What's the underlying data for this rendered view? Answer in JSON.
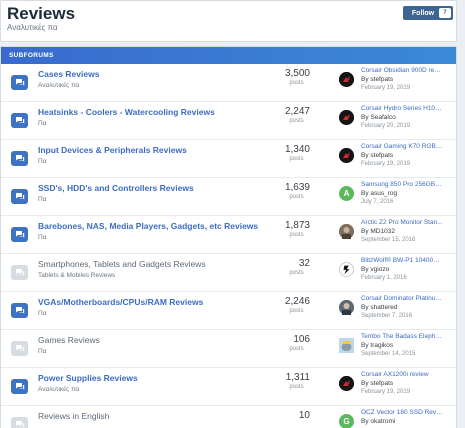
{
  "header": {
    "title": "Reviews",
    "subtitle": "Αναλυτικές πα",
    "follow_label": "Follow",
    "follow_count": "7"
  },
  "section": {
    "title": "SUBFORUMS"
  },
  "colors": {
    "accent": "#3d72c4",
    "read_icon": "#d7dce2",
    "link": "#3d6cc0",
    "follow_btn": "#3d6594"
  },
  "rows": [
    {
      "name": "Cases Reviews",
      "desc": "Αναλυτικές πα",
      "count": "3,500",
      "count_label": "posts",
      "unread": true,
      "last_title": "Corsair Obsidian 900D revi...",
      "last_by": "By stefpats",
      "last_date": "February 19, 2019",
      "avatar": "corsair",
      "avatar_letter": ""
    },
    {
      "name": "Heatsinks - Coolers - Watercooling Reviews",
      "desc": "Πα",
      "count": "2,247",
      "count_label": "posts",
      "unread": true,
      "last_title": "Corsair Hydro Series H100i...",
      "last_by": "By Seafalco",
      "last_date": "February 20, 2019",
      "avatar": "corsair",
      "avatar_letter": ""
    },
    {
      "name": "Input Devices & Peripherals Reviews",
      "desc": "Πα",
      "count": "1,340",
      "count_label": "posts",
      "unread": true,
      "last_title": "Corsair Gaming K70 RGB Ful...",
      "last_by": "By stefpats",
      "last_date": "February 19, 2019",
      "avatar": "corsair",
      "avatar_letter": ""
    },
    {
      "name": "SSD's, HDD's and Controllers Reviews",
      "desc": "Πα",
      "count": "1,639",
      "count_label": "posts",
      "unread": true,
      "last_title": "Samsung 850 Pro 256GB SSD ...",
      "last_by": "By asus_rog",
      "last_date": "July 7, 2016",
      "avatar": "letter",
      "avatar_letter": "A"
    },
    {
      "name": "Barebones, NAS, Media Players, Gadgets, etc Reviews",
      "desc": "Πα",
      "count": "1,873",
      "count_label": "posts",
      "unread": true,
      "last_title": "Arctic Z2 Pro Monitor Stan...",
      "last_by": "By MD1032",
      "last_date": "September 15, 2016",
      "avatar": "photo",
      "avatar_letter": ""
    },
    {
      "name": "Smartphones, Tablets and Gadgets Reviews",
      "desc": "Tablets & Mobiles Reviews",
      "count": "32",
      "count_label": "posts",
      "unread": false,
      "last_title": "BlitzWolf® BW-P1 10400mAh ...",
      "last_by": "By vgiozo",
      "last_date": "February 1, 2016",
      "avatar": "blitz",
      "avatar_letter": ""
    },
    {
      "name": "VGAs/Motherboards/CPUs/RAM Reviews",
      "desc": "Πα",
      "count": "2,246",
      "count_label": "posts",
      "unread": true,
      "last_title": "Corsair Dominator Platinum...",
      "last_by": "By shattered",
      "last_date": "September 7, 2016",
      "avatar": "photo2",
      "avatar_letter": ""
    },
    {
      "name": "Games Reviews",
      "desc": "Πα",
      "count": "106",
      "count_label": "posts",
      "unread": false,
      "last_title": "Tembo The Badass Elephant ...",
      "last_by": "By tragikos",
      "last_date": "September 14, 2015",
      "avatar": "tembo",
      "avatar_letter": ""
    },
    {
      "name": "Power Supplies Reviews",
      "desc": "Αναλυτικές πα",
      "count": "1,311",
      "count_label": "posts",
      "unread": true,
      "last_title": "Corsair AX1200i review",
      "last_by": "By stefpats",
      "last_date": "February 19, 2019",
      "avatar": "corsair",
      "avatar_letter": ""
    },
    {
      "name": "Reviews in English",
      "desc": "",
      "count": "10",
      "count_label": "",
      "unread": false,
      "last_title": "OCZ Vector 180 SSD Review ...",
      "last_by": "By okatromi",
      "last_date": "",
      "avatar": "letter",
      "avatar_letter": "G"
    }
  ]
}
